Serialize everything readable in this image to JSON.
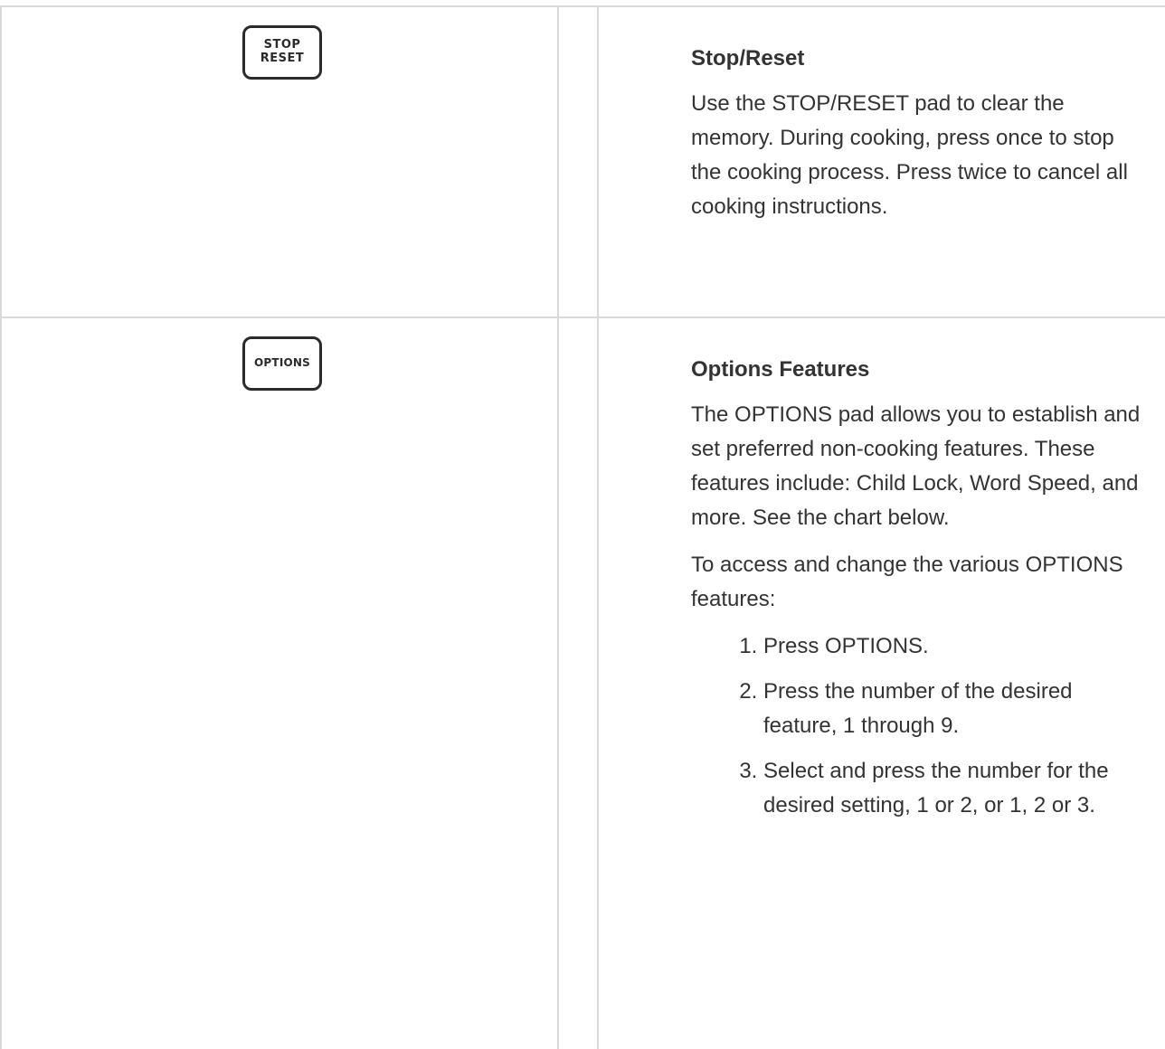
{
  "rows": [
    {
      "button_lines": [
        "STOP",
        "RESET"
      ],
      "title": "Stop/Reset",
      "paragraphs": [
        "Use the STOP/RESET pad to clear the memory. During cooking, press once to stop the cooking process. Press twice to cancel all cooking instructions."
      ]
    },
    {
      "button_lines": [
        "OPTIONS"
      ],
      "title": "Options Features",
      "paragraphs": [
        "The OPTIONS pad allows you to establish and set preferred non-cooking features. These features include: Child Lock, Word Speed, and more. See the chart below.",
        "To access and change the various OPTIONS features:"
      ],
      "steps": [
        "Press OPTIONS.",
        "Press the number of the desired feature, 1 through 9.",
        "Select and press the number for the desired setting, 1 or 2, or 1, 2 or 3."
      ]
    }
  ]
}
